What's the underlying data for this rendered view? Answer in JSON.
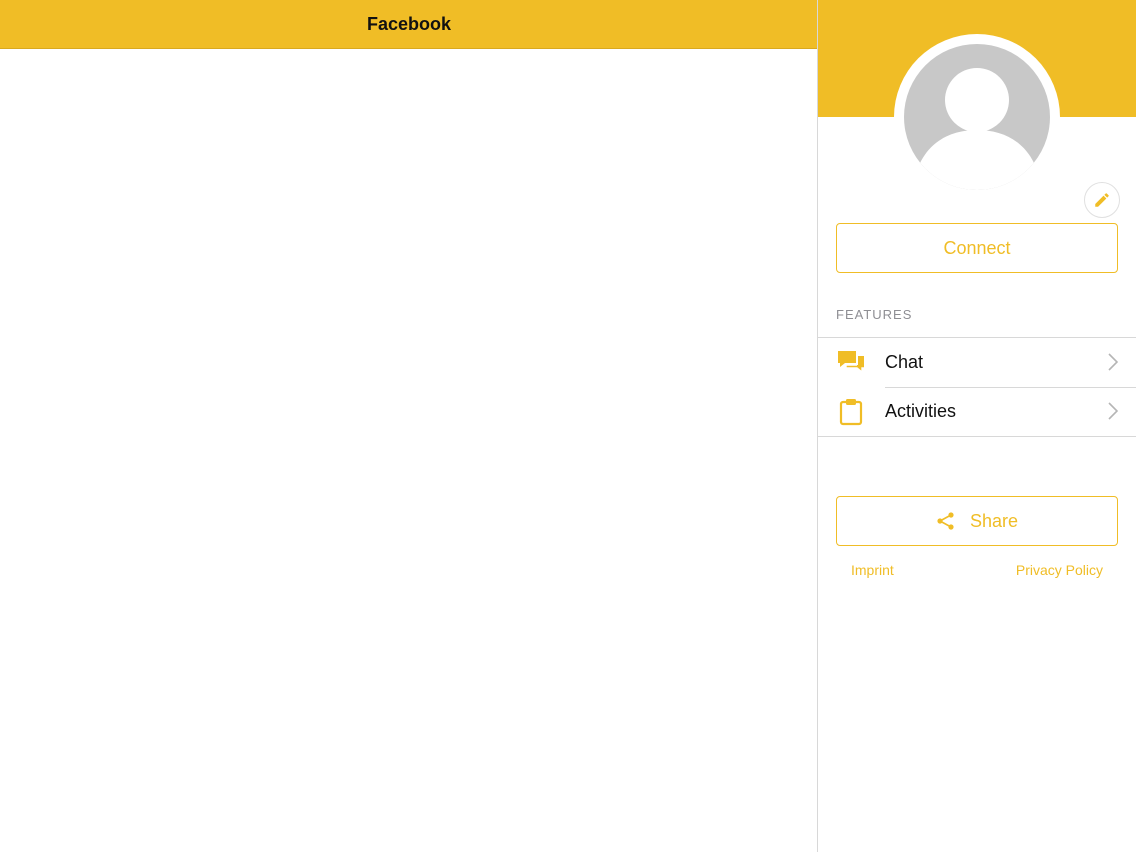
{
  "navbar": {
    "title": "Facebook"
  },
  "profile": {
    "avatar_icon": "default-user-avatar-icon",
    "edit_icon": "pencil-icon",
    "connect_label": "Connect"
  },
  "features": {
    "section_label": "FEATURES",
    "items": [
      {
        "label": "Chat",
        "icon": "chat-bubbles-icon"
      },
      {
        "label": "Activities",
        "icon": "clipboard-icon"
      }
    ]
  },
  "share": {
    "label": "Share",
    "icon": "share-icon"
  },
  "footer_links": {
    "imprint": "Imprint",
    "privacy": "Privacy Policy"
  },
  "colors": {
    "accent": "#f0bd26",
    "avatar_gray": "#c8c8c8",
    "divider": "#d8d8d8",
    "section_label": "#8e8e93"
  }
}
